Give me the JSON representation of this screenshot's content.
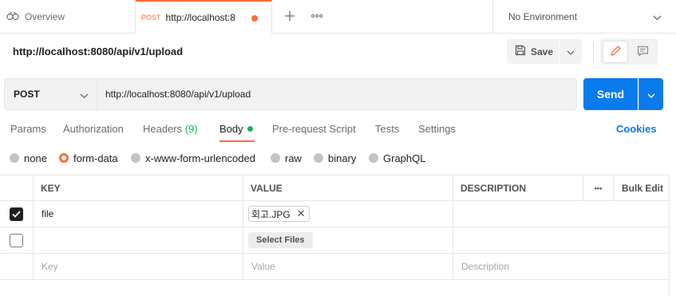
{
  "tabs": {
    "overview_label": "Overview",
    "active": {
      "method": "POST",
      "label": "http://localhost:8"
    },
    "environment": "No Environment"
  },
  "request": {
    "title": "http://localhost:8080/api/v1/upload",
    "save_label": "Save",
    "method": "POST",
    "url": "http://localhost:8080/api/v1/upload",
    "send_label": "Send"
  },
  "request_tabs": {
    "params": "Params",
    "authorization": "Authorization",
    "headers": "Headers",
    "headers_count": "(9)",
    "body": "Body",
    "prerequest": "Pre-request Script",
    "tests": "Tests",
    "settings": "Settings",
    "cookies": "Cookies"
  },
  "body_types": {
    "none": "none",
    "form_data": "form-data",
    "urlencoded": "x-www-form-urlencoded",
    "raw": "raw",
    "binary": "binary",
    "graphql": "GraphQL",
    "selected": "form-data"
  },
  "table": {
    "headers": {
      "key": "KEY",
      "value": "VALUE",
      "description": "DESCRIPTION",
      "more": "•••",
      "bulk_edit": "Bulk Edit"
    },
    "rows": [
      {
        "checked": true,
        "key": "file",
        "value_file": "회고.JPG"
      },
      {
        "checked": false,
        "select_files_label": "Select Files"
      }
    ],
    "placeholders": {
      "key": "Key",
      "value": "Value",
      "description": "Description"
    }
  },
  "colors": {
    "accent": "#ff6c37",
    "primary": "#097bed",
    "success": "#0cbb52"
  }
}
